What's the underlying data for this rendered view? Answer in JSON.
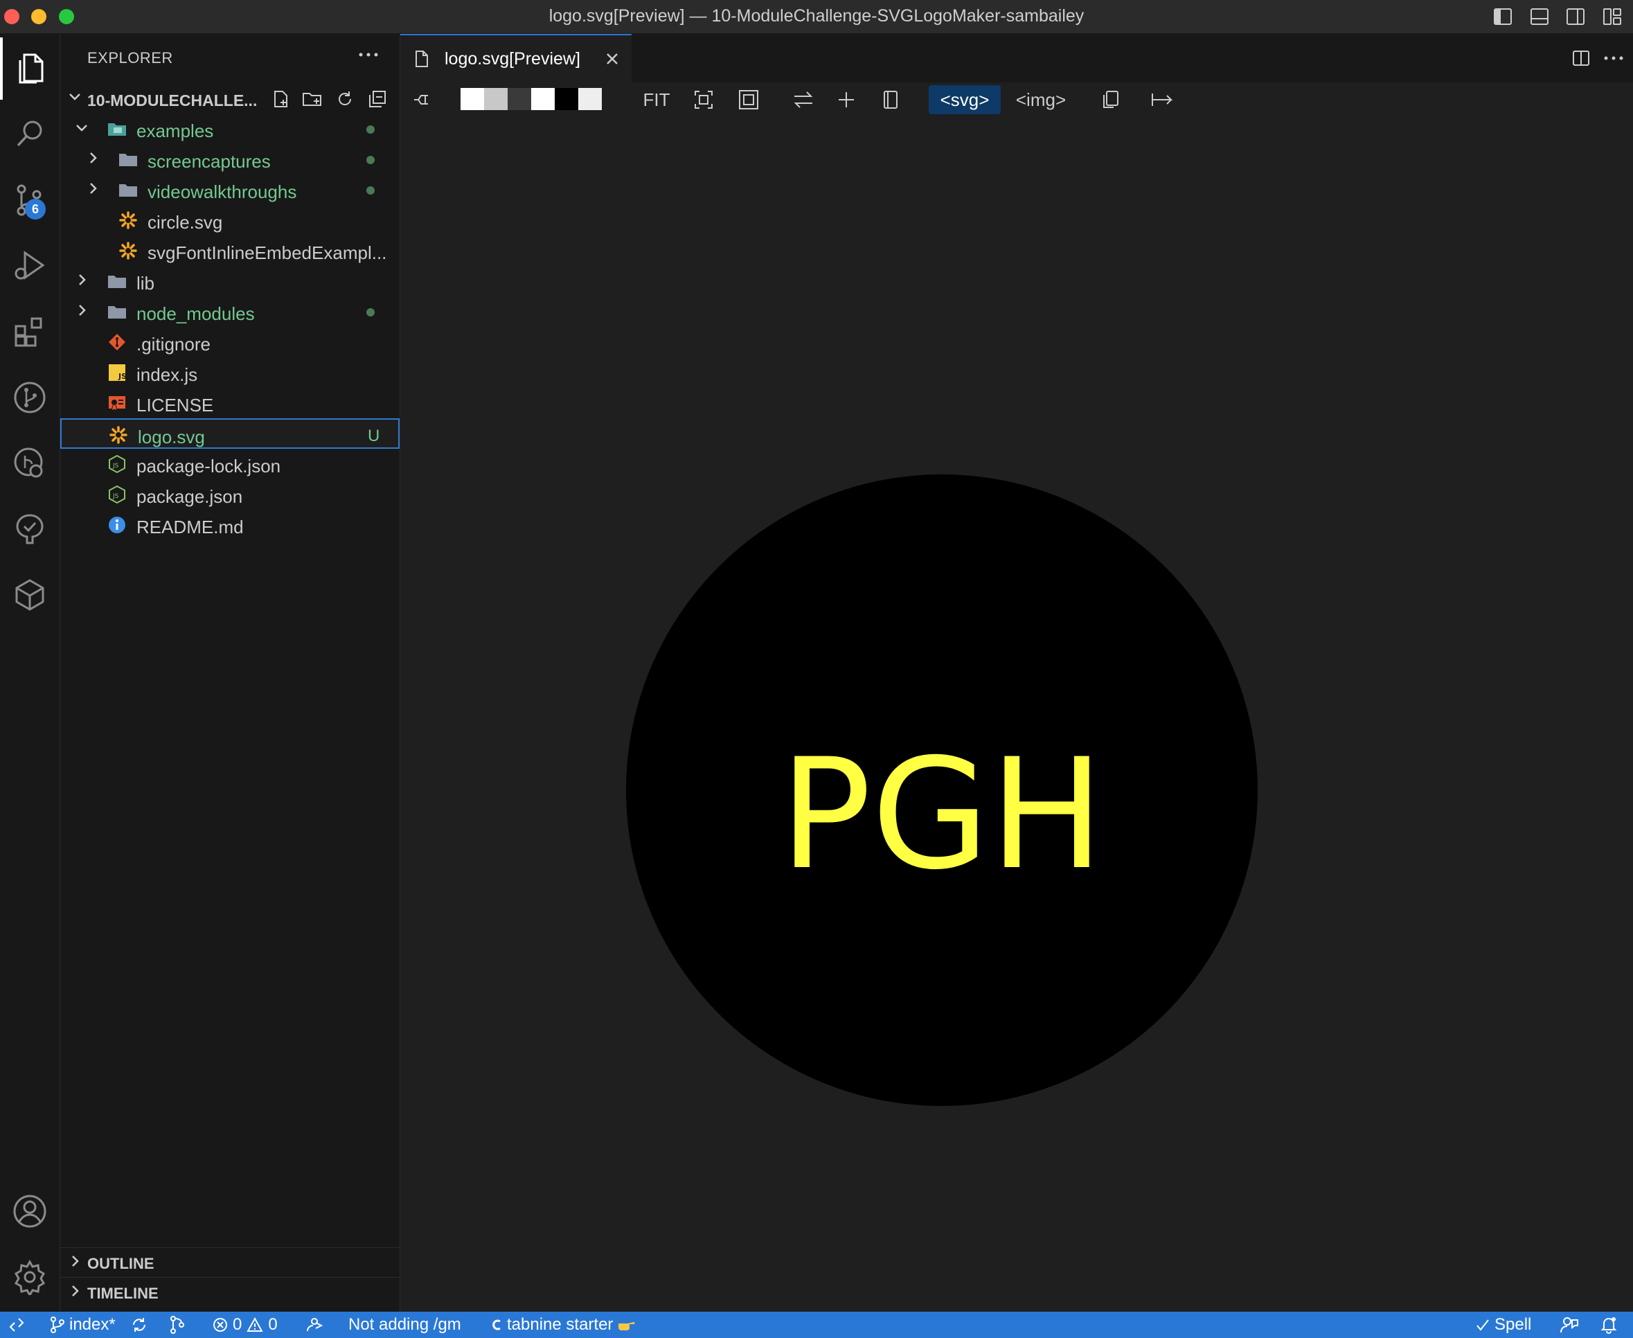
{
  "window": {
    "title": "logo.svg[Preview] — 10-ModuleChallenge-SVGLogoMaker-sambailey"
  },
  "activity_bar": {
    "source_control_badge": "6"
  },
  "sidebar": {
    "title": "EXPLORER",
    "project_name": "10-MODULECHALLE...",
    "tree": [
      {
        "label": "examples",
        "type": "folder-open",
        "level": 0,
        "color": "green",
        "status": "dot"
      },
      {
        "label": "screencaptures",
        "type": "folder",
        "level": 1,
        "color": "green",
        "status": "dot"
      },
      {
        "label": "videowalkthroughs",
        "type": "folder",
        "level": 1,
        "color": "green",
        "status": "dot"
      },
      {
        "label": "circle.svg",
        "type": "svg",
        "level": 1,
        "color": "plain",
        "status": ""
      },
      {
        "label": "svgFontInlineEmbedExampl...",
        "type": "svg",
        "level": 1,
        "color": "plain",
        "status": ""
      },
      {
        "label": "lib",
        "type": "folder",
        "level": 0,
        "color": "plain",
        "status": ""
      },
      {
        "label": "node_modules",
        "type": "folder",
        "level": 0,
        "color": "green",
        "status": "dot"
      },
      {
        "label": ".gitignore",
        "type": "git",
        "level": 0,
        "color": "plain",
        "status": ""
      },
      {
        "label": "index.js",
        "type": "js",
        "level": 0,
        "color": "plain",
        "status": ""
      },
      {
        "label": "LICENSE",
        "type": "license",
        "level": 0,
        "color": "plain",
        "status": ""
      },
      {
        "label": "logo.svg",
        "type": "svg",
        "level": 0,
        "color": "green",
        "status": "U"
      },
      {
        "label": "package-lock.json",
        "type": "json",
        "level": 0,
        "color": "plain",
        "status": ""
      },
      {
        "label": "package.json",
        "type": "json",
        "level": 0,
        "color": "plain",
        "status": ""
      },
      {
        "label": "README.md",
        "type": "info",
        "level": 0,
        "color": "plain",
        "status": ""
      }
    ],
    "outline_label": "OUTLINE",
    "timeline_label": "TIMELINE"
  },
  "editor": {
    "tab_label": "logo.svg[Preview]",
    "toolbar": {
      "fit_label": "FIT",
      "svg_label": "<svg>",
      "img_label": "<img>",
      "background_swatches": [
        "#ffffff",
        "#c8c8c8",
        "#3a3a3a",
        "#ffffff",
        "#000000",
        "#eeeeee"
      ]
    },
    "preview": {
      "text": "PGH",
      "circle_color": "#000000",
      "text_color": "#ffff44"
    }
  },
  "status_bar": {
    "branch": "index*",
    "errors": "0",
    "warnings": "0",
    "message": "Not adding /gm",
    "tabnine": "tabnine starter",
    "spell": "Spell"
  },
  "colors": {
    "accent": "#2a78d6",
    "git_added": "#73c991"
  }
}
